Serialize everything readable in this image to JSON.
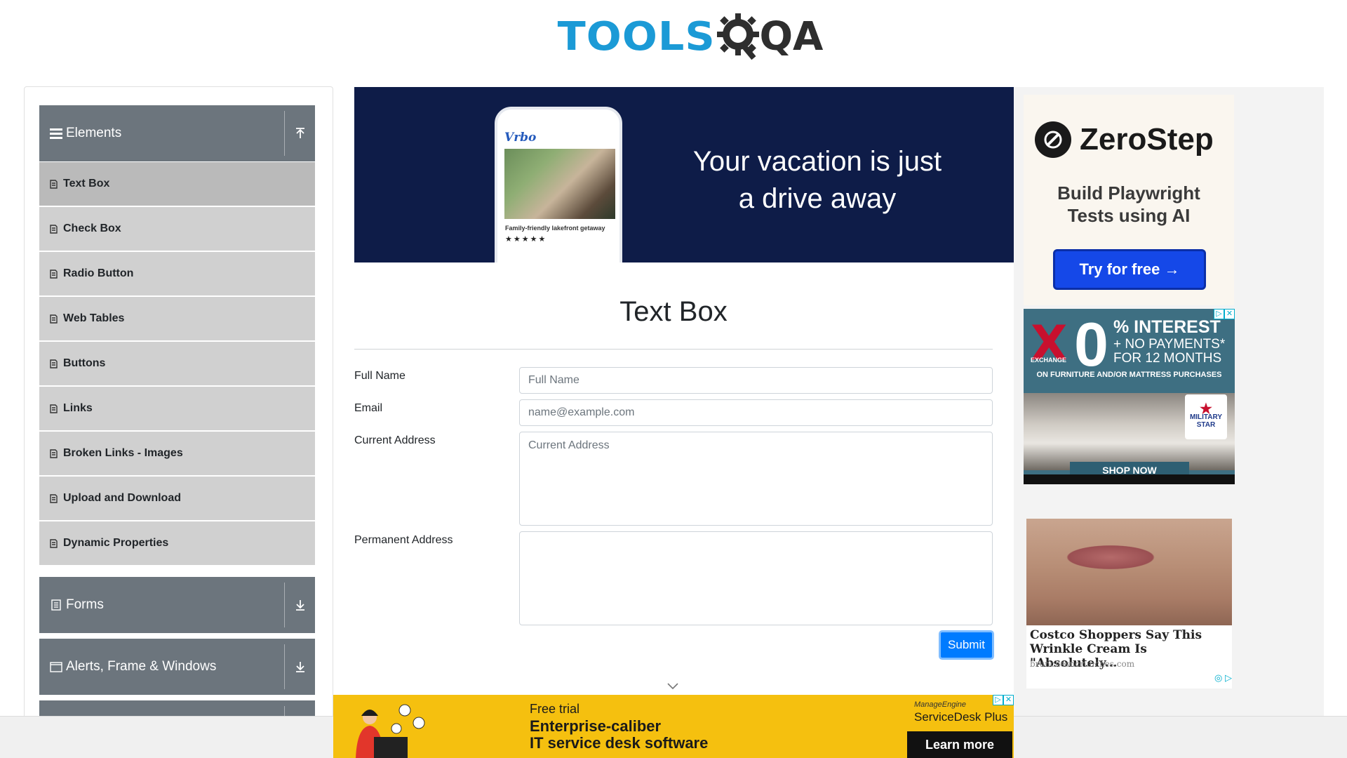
{
  "header": {
    "logo_tools": "TOOLS",
    "logo_qa": "QA"
  },
  "sidebar": {
    "groups": [
      {
        "label": "Elements",
        "icon": "hamburger-icon",
        "toggle_icon": "collapse-up-icon"
      },
      {
        "label": "Forms",
        "icon": "document-icon",
        "toggle_icon": "expand-down-icon"
      },
      {
        "label": "Alerts, Frame & Windows",
        "icon": "window-icon",
        "toggle_icon": "expand-down-icon"
      }
    ],
    "items": [
      {
        "label": "Text Box",
        "active": true
      },
      {
        "label": "Check Box"
      },
      {
        "label": "Radio Button"
      },
      {
        "label": "Web Tables"
      },
      {
        "label": "Buttons"
      },
      {
        "label": "Links"
      },
      {
        "label": "Broken Links - Images"
      },
      {
        "label": "Upload and Download"
      },
      {
        "label": "Dynamic Properties"
      }
    ]
  },
  "ads": {
    "vrbo": {
      "brand": "Vrbo",
      "caption": "Family-friendly lakefront getaway",
      "stars": "★★★★★",
      "tagline_1": "Your vacation is just",
      "tagline_2": "a drive away"
    },
    "zerostep": {
      "name": "ZeroStep",
      "sub_1": "Build Playwright",
      "sub_2": "Tests using AI",
      "button": "Try for free →"
    },
    "exchange": {
      "brand": "EXCHANGE",
      "zero": "0",
      "line1": "% INTEREST",
      "line2": "+ NO PAYMENTS*",
      "line3": "FOR 12 MONTHS",
      "line4": "ON FURNITURE AND/OR MATTRESS PURCHASES",
      "badge_1": "MILITARY",
      "badge_2": "STAR",
      "cta": "SHOP NOW"
    },
    "cream": {
      "title": "Costco Shoppers Say This Wrinkle Cream Is \"Absolutely...",
      "source": "brunchesncrunches.com"
    },
    "servicedesk": {
      "free_trial": "Free trial",
      "line1": "Enterprise-caliber",
      "line2": "IT service desk software",
      "brand": "ManageEngine",
      "product": "ServiceDesk Plus",
      "button": "Learn more"
    }
  },
  "main": {
    "title": "Text Box",
    "form": {
      "full_name": {
        "label": "Full Name",
        "placeholder": "Full Name",
        "value": ""
      },
      "email": {
        "label": "Email",
        "placeholder": "name@example.com",
        "value": ""
      },
      "current_address": {
        "label": "Current Address",
        "placeholder": "Current Address",
        "value": ""
      },
      "permanent_address": {
        "label": "Permanent Address",
        "placeholder": "",
        "value": ""
      },
      "submit_label": "Submit"
    }
  },
  "colors": {
    "sidebar_header": "#6c757d",
    "sidebar_item": "#d0d0d0",
    "sidebar_item_active": "#bababa",
    "primary": "#007bff",
    "logo_blue": "#1b9ad6"
  }
}
